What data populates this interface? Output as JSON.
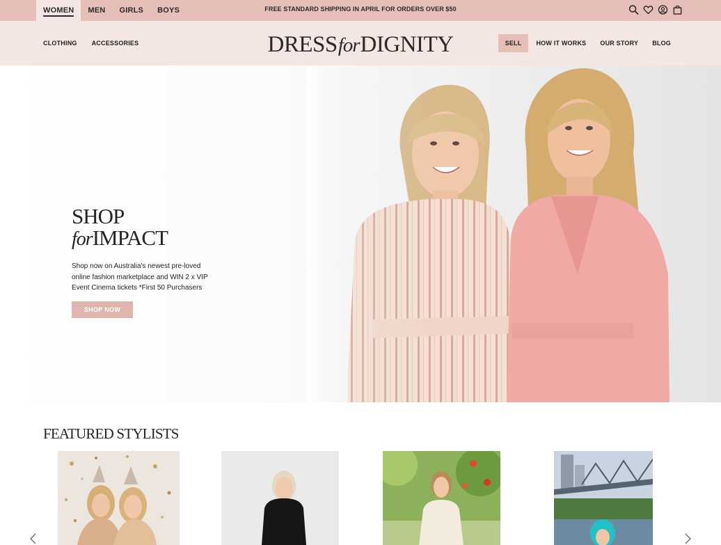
{
  "topbar": {
    "gender_tabs": [
      {
        "label": "WOMEN",
        "active": true
      },
      {
        "label": "MEN",
        "active": false
      },
      {
        "label": "GIRLS",
        "active": false
      },
      {
        "label": "BOYS",
        "active": false
      }
    ],
    "promo": "FREE STANDARD SHIPPING IN APRIL FOR ORDERS OVER $50",
    "icons": [
      "search-icon",
      "heart-icon",
      "account-icon",
      "bag-icon"
    ]
  },
  "nav": {
    "left": [
      "CLOTHING",
      "ACCESSORIES"
    ],
    "logo": {
      "part1": "DRESS",
      "part2": "for",
      "part3": "DIGNITY"
    },
    "right": [
      "SELL",
      "HOW IT WORKS",
      "OUR STORY",
      "BLOG"
    ]
  },
  "hero": {
    "title_line1": "SHOP",
    "title_for": "for",
    "title_impact": "IMPACT",
    "copy_line1": "Shop now on Australia's newest pre-loved",
    "copy_line2": "online fashion marketplace and WIN 2 x VIP",
    "copy_line3": "Event Cinema tickets *First 50 Purchasers",
    "button": "SHOP NOW"
  },
  "featured": {
    "title": "FEATURED STYLISTS"
  },
  "colors": {
    "topbar_bg": "#e5bfb8",
    "nav_bg": "#f3e6e3",
    "accent": "#e0b5ad",
    "text": "#1f1f1f"
  }
}
